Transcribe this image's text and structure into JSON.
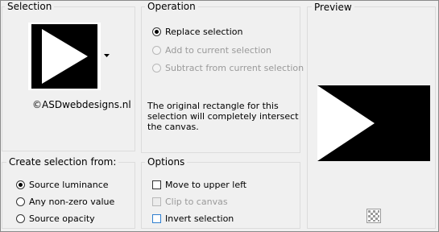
{
  "selection": {
    "title": "Selection",
    "watermark": "©ASDwebdesigns.nl",
    "shape_icon": "triangle-right-icon",
    "dropdown_icon": "caret-down-icon"
  },
  "operation": {
    "title": "Operation",
    "options": [
      {
        "label": "Replace selection",
        "checked": true,
        "enabled": true
      },
      {
        "label": "Add to current selection",
        "checked": false,
        "enabled": false
      },
      {
        "label": "Subtract from current selection",
        "checked": false,
        "enabled": false
      }
    ],
    "note_lines": [
      "The original rectangle for this",
      "selection will completely intersect",
      "the canvas."
    ]
  },
  "preview": {
    "title": "Preview",
    "transparency_icon": "checkerboard-icon"
  },
  "create_from": {
    "title": "Create selection from:",
    "options": [
      {
        "label": "Source luminance",
        "checked": true
      },
      {
        "label": "Any non-zero value",
        "checked": false
      },
      {
        "label": "Source opacity",
        "checked": false
      }
    ]
  },
  "options": {
    "title": "Options",
    "items": [
      {
        "label": "Move to upper left",
        "checked": false,
        "enabled": true
      },
      {
        "label": "Clip to canvas",
        "checked": false,
        "enabled": false
      },
      {
        "label": "Invert selection",
        "checked": false,
        "enabled": true
      }
    ]
  },
  "colors": {
    "background": "#f0f0f0",
    "group_border": "#dcdcdc",
    "focus_border": "#2f7fd0"
  }
}
